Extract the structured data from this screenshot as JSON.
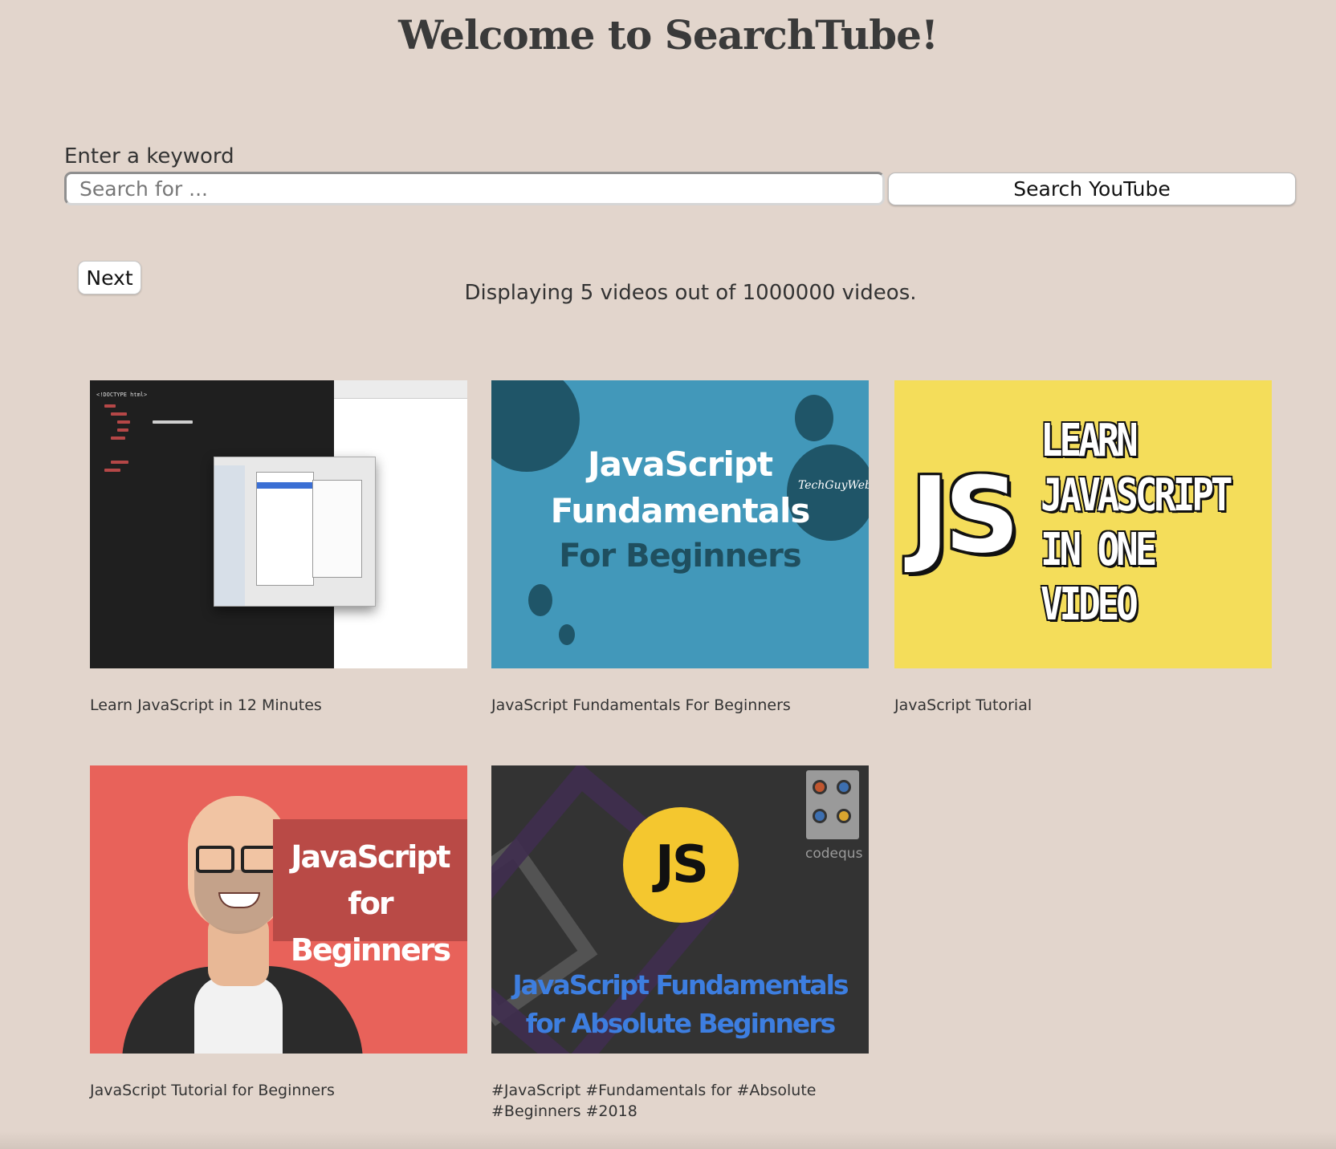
{
  "header": {
    "title": "Welcome to SearchTube!"
  },
  "search": {
    "label": "Enter a keyword",
    "placeholder": "Search for ...",
    "value": "",
    "button_label": "Search YouTube"
  },
  "pagination": {
    "next_label": "Next"
  },
  "results": {
    "summary": "Displaying 5 videos out of 1000000 videos.",
    "videos": [
      {
        "title": "Learn JavaScript in 12 Minutes",
        "thumbnail": {
          "type": "code-editor-screenshot",
          "code_text": "<!DOCTYPE html>"
        }
      },
      {
        "title": "JavaScript Fundamentals For Beginners",
        "thumbnail": {
          "line1": "JavaScript",
          "line2": "Fundamentals",
          "line3": "For Beginners",
          "brand": "TechGuyWeb",
          "background": "#4298ba"
        }
      },
      {
        "title": "JavaScript Tutorial",
        "thumbnail": {
          "mark": "JS",
          "lines": [
            "LEARN",
            "JAVASCRIPT",
            "IN ONE",
            "VIDEO"
          ],
          "background": "#f4dd5a"
        }
      },
      {
        "title": "JavaScript Tutorial for Beginners",
        "thumbnail": {
          "line1": "JavaScript for",
          "line2": "Beginners",
          "background": "#e8625a"
        }
      },
      {
        "title": "#JavaScript #Fundamentals for #Absolute #Beginners #2018",
        "thumbnail": {
          "mark": "JS",
          "brand": "codequs",
          "line1": "JavaScript Fundamentals",
          "line2": "for Absolute Beginners",
          "background": "#333333"
        }
      }
    ]
  }
}
